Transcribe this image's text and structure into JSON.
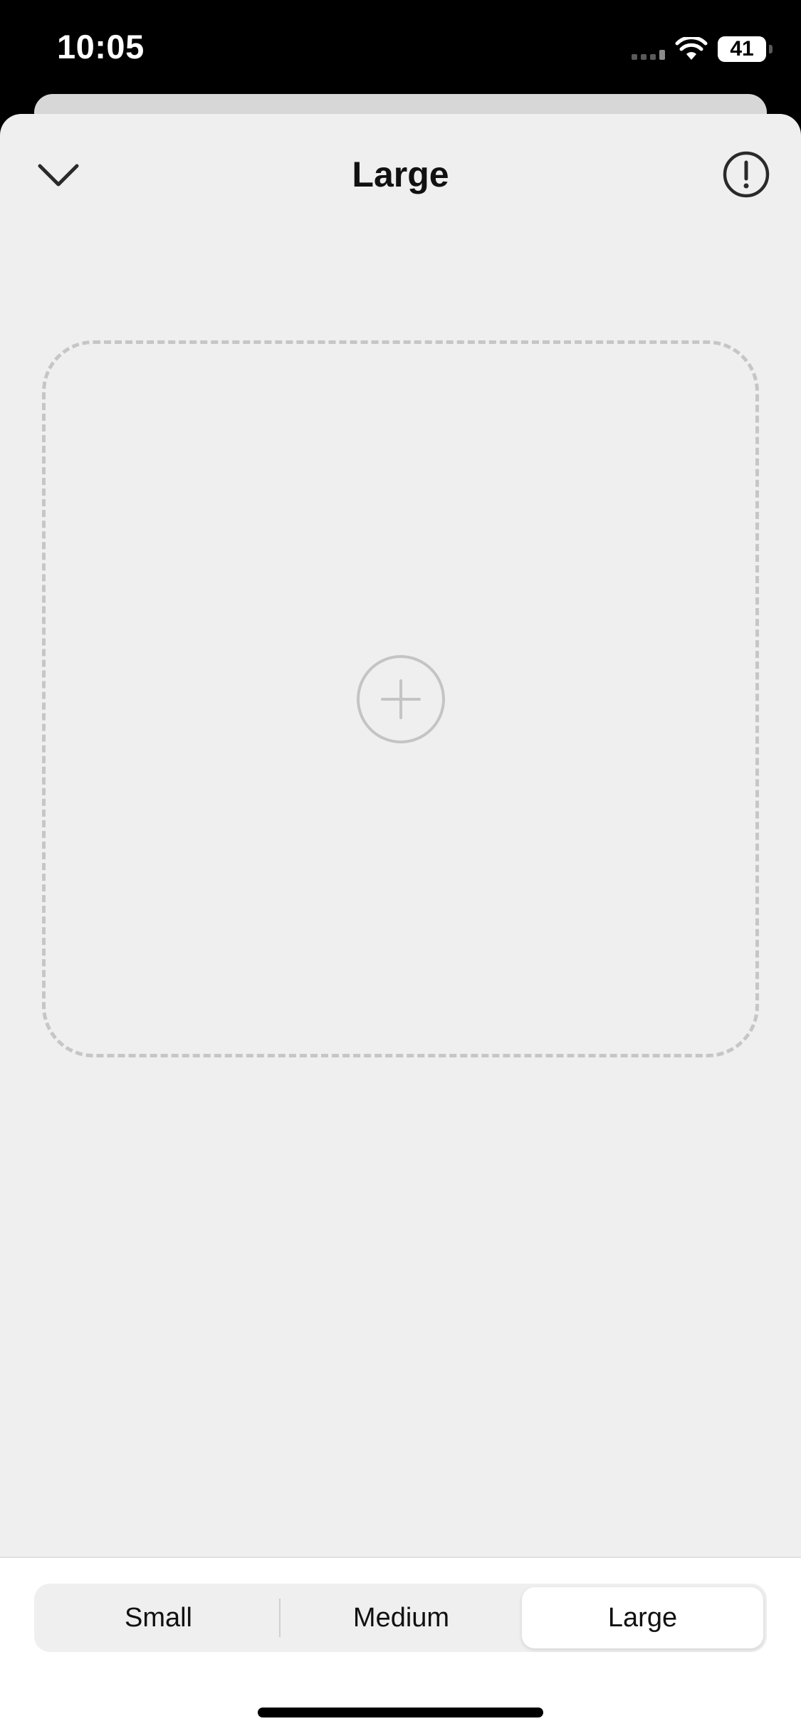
{
  "status_bar": {
    "time": "10:05",
    "battery_percent": "41",
    "battery_level": 0.41,
    "signal_icon": "cellular-signal-icon",
    "wifi_icon": "wifi-icon"
  },
  "header": {
    "title": "Large",
    "collapse_icon": "chevron-down-icon",
    "info_icon": "exclamation-circle-icon"
  },
  "widget_slot": {
    "add_icon": "plus-circle-icon"
  },
  "size_picker": {
    "options": [
      "Small",
      "Medium",
      "Large"
    ],
    "selected": "Large"
  },
  "colors": {
    "sheet_background": "#efefef",
    "dashed_border": "#c6c6c6",
    "text": "#111111"
  }
}
